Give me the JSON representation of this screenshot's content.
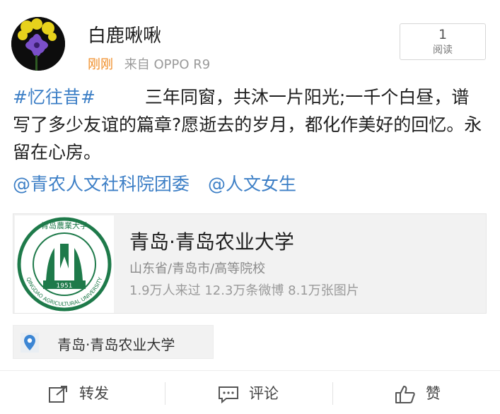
{
  "post": {
    "author": "白鹿啾啾",
    "time": "刚刚",
    "source": "来自 OPPO R9",
    "read_count": "1",
    "read_label": "阅读",
    "hashtag": "#忆往昔#",
    "body": "三年同窗，共沐一片阳光;一千个白昼，谱写了多少友谊的篇章?愿逝去的岁月，都化作美好的回忆。永留在心房。",
    "mentions": [
      "@青农人文社科院团委",
      "@人文女生"
    ]
  },
  "card": {
    "title": "青岛·青岛农业大学",
    "subtitle": "山东省/青岛市/高等院校",
    "stats": "1.9万人来过 12.3万条微博 8.1万张图片",
    "logo_year": "1951",
    "logo_ring_text": "QINGDAO AGRICULTURAL UNIVERSITY",
    "logo_calligraphy": "青岛農業大学"
  },
  "location": {
    "label": "青岛·青岛农业大学"
  },
  "actions": {
    "repost": "转发",
    "comment": "评论",
    "like": "赞"
  },
  "colors": {
    "link": "#3d7fc6",
    "time": "#f08c25",
    "logo_green": "#1e7a4a"
  },
  "icons": [
    "avatar-flower",
    "map-pin-icon",
    "repost-icon",
    "comment-icon",
    "like-icon"
  ]
}
